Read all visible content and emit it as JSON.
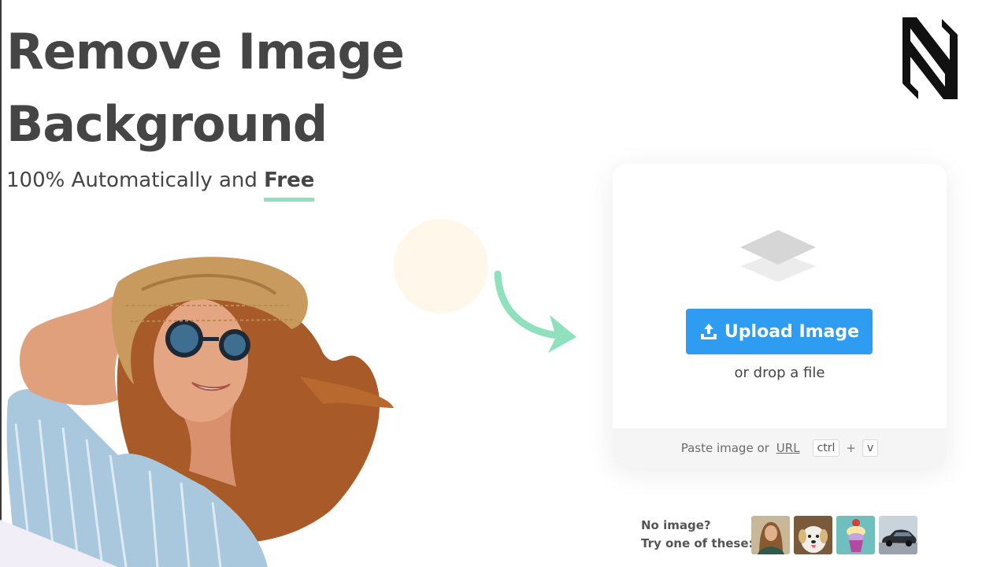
{
  "hero": {
    "title_line1": "Remove Image",
    "title_line2": "Background",
    "subtitle_prefix": "100% Automatically and ",
    "subtitle_emphasis": "Free"
  },
  "upload": {
    "button_label": "Upload Image",
    "drop_text": "or drop a file",
    "paste_prefix": "Paste image or",
    "paste_link": "URL",
    "key_ctrl": "ctrl",
    "key_plus": "+",
    "key_v": "v"
  },
  "samples": {
    "line1": "No image?",
    "line2": "Try one of these:",
    "items": [
      "woman",
      "dog",
      "cupcake",
      "car"
    ]
  },
  "colors": {
    "accent_blue": "#2e9cf0",
    "accent_green": "#8fe0bc",
    "text_dark": "#454545"
  },
  "icons": {
    "upload_button": "upload-icon",
    "card_top": "layers-icon",
    "decor": "arrow-icon",
    "brand": "brand-logo"
  }
}
